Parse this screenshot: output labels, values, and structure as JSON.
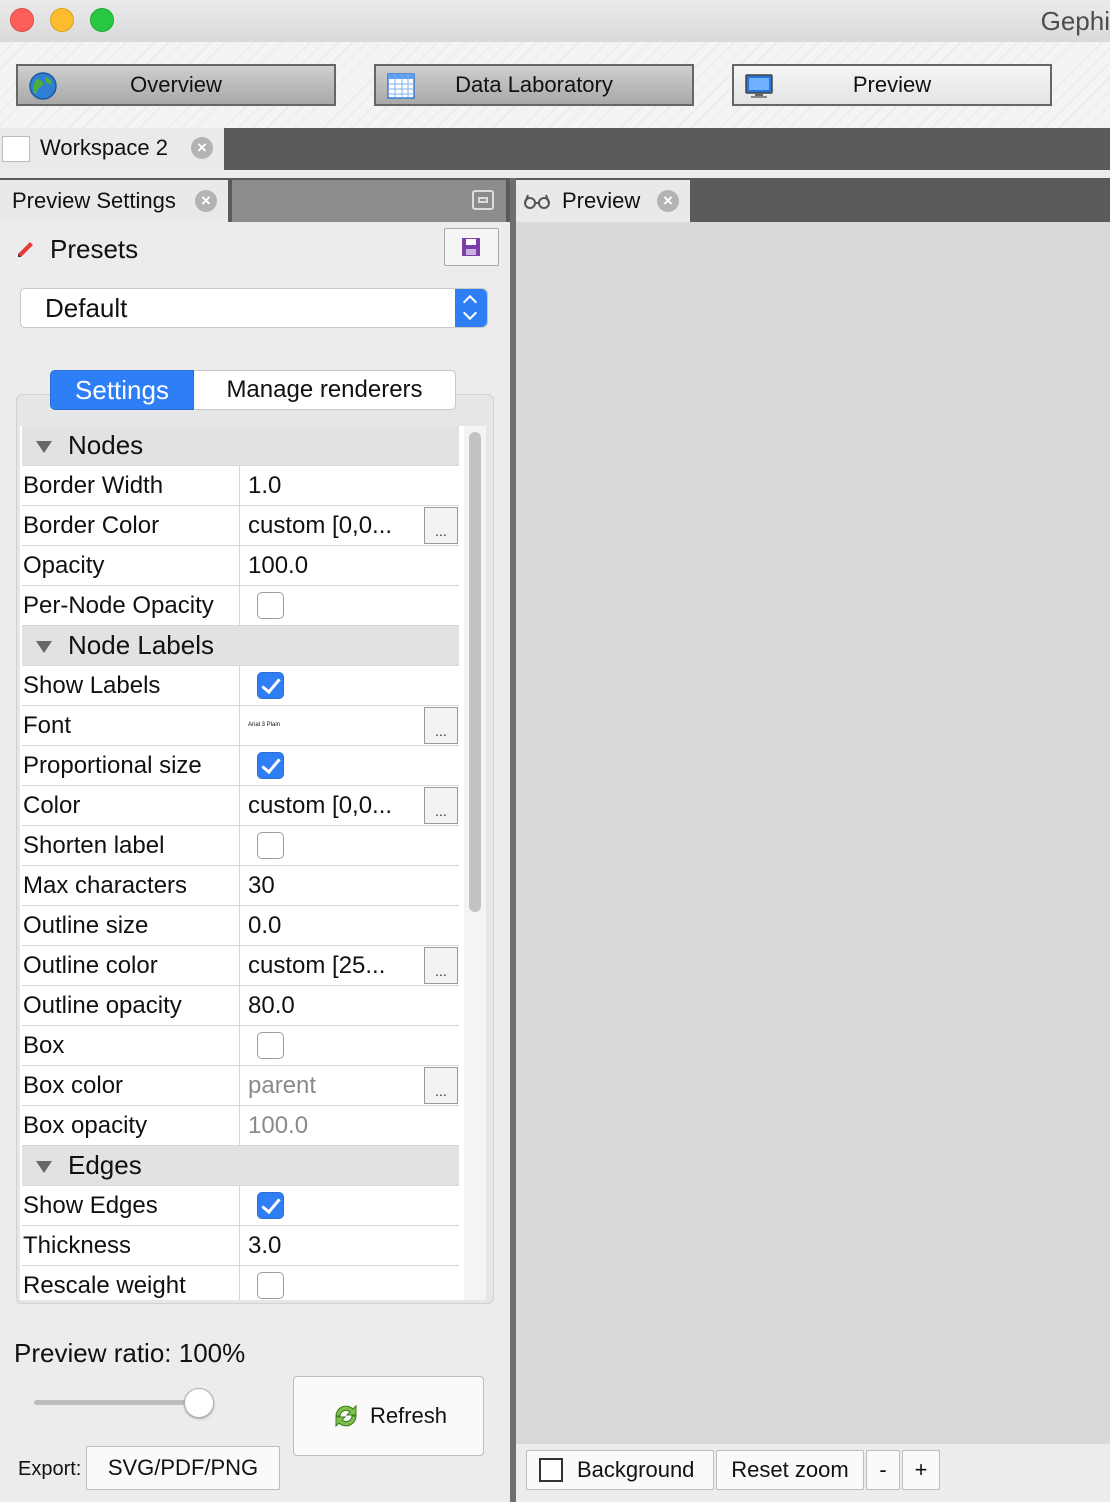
{
  "window": {
    "title": "Gephi"
  },
  "modes": {
    "overview": "Overview",
    "data_laboratory": "Data Laboratory",
    "preview": "Preview"
  },
  "workspace": {
    "tab_label": "Workspace 2"
  },
  "left_panel": {
    "tab_label": "Preview Settings",
    "presets_label": "Presets",
    "preset_selected": "Default",
    "subtabs": {
      "settings": "Settings",
      "manage": "Manage renderers"
    },
    "sections": {
      "nodes": "Nodes",
      "node_labels": "Node Labels",
      "edges": "Edges"
    },
    "rows": {
      "border_width": {
        "label": "Border Width",
        "value": "1.0"
      },
      "border_color": {
        "label": "Border Color",
        "value": "custom [0,0..."
      },
      "opacity": {
        "label": "Opacity",
        "value": "100.0"
      },
      "per_node_opacity": {
        "label": "Per-Node Opacity",
        "checked": false
      },
      "show_labels": {
        "label": "Show Labels",
        "checked": true
      },
      "font": {
        "label": "Font",
        "value": "Arial 3 Plain"
      },
      "proportional_size": {
        "label": "Proportional size",
        "checked": true
      },
      "color": {
        "label": "Color",
        "value": "custom [0,0..."
      },
      "shorten_label": {
        "label": "Shorten label",
        "checked": false
      },
      "max_characters": {
        "label": "Max characters",
        "value": "30"
      },
      "outline_size": {
        "label": "Outline size",
        "value": "0.0"
      },
      "outline_color": {
        "label": "Outline color",
        "value": "custom [25..."
      },
      "outline_opacity": {
        "label": "Outline opacity",
        "value": "80.0"
      },
      "box": {
        "label": "Box",
        "checked": false
      },
      "box_color": {
        "label": "Box color",
        "value": "parent"
      },
      "box_opacity": {
        "label": "Box opacity",
        "value": "100.0"
      },
      "show_edges": {
        "label": "Show Edges",
        "checked": true
      },
      "thickness": {
        "label": "Thickness",
        "value": "3.0"
      },
      "rescale_weight": {
        "label": "Rescale weight",
        "checked": false
      }
    },
    "ellipsis": "...",
    "preview_ratio_label": "Preview ratio:",
    "preview_ratio_value": "100%",
    "ratio_slider_value": 1.0,
    "refresh_label": "Refresh",
    "export_label": "Export:",
    "export_button": "SVG/PDF/PNG"
  },
  "right_panel": {
    "tab_label": "Preview",
    "background_label": "Background",
    "background_checked": false,
    "reset_zoom": "Reset zoom",
    "zoom_out": "-",
    "zoom_in": "+"
  },
  "colors": {
    "accent": "#2e7ef5",
    "dark_bar": "#5a5a5a",
    "panel_bg": "#ececec",
    "preview_bg": "#d9d9d9"
  }
}
